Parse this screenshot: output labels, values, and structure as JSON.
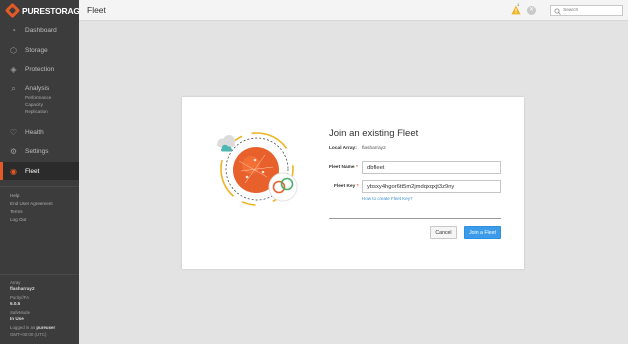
{
  "brand": {
    "logo_text": "PURESTORAGE",
    "accent": "#e25a26"
  },
  "sidebar": {
    "nav": [
      {
        "label": "Dashboard",
        "icon": "dashboard-icon"
      },
      {
        "label": "Storage",
        "icon": "storage-icon"
      },
      {
        "label": "Protection",
        "icon": "shield-icon"
      },
      {
        "label": "Analysis",
        "icon": "analysis-icon"
      },
      {
        "label": "Health",
        "icon": "health-icon"
      },
      {
        "label": "Settings",
        "icon": "gear-icon"
      },
      {
        "label": "Fleet",
        "icon": "fleet-icon"
      }
    ],
    "analysis_sub": [
      "Performance",
      "Capacity",
      "Replication"
    ],
    "active": "Fleet",
    "help_links": [
      "Help",
      "End User Agreement",
      "Terms",
      "Log Out"
    ],
    "info": {
      "array_label": "Array",
      "array_value": "flasharray2",
      "purity_label": "Purity//FA",
      "purity_value": "6.0.5",
      "safemode_label": "SafeMode",
      "safemode_value": "In Use",
      "logged_in_text": "Logged in as",
      "user": "pureuser",
      "timezone": "GMT+00:00 (UTC)"
    }
  },
  "topbar": {
    "title": "Fleet",
    "alert_count": "1",
    "search_placeholder": "Search"
  },
  "dialog": {
    "title": "Join an existing Fleet",
    "local_array_label": "Local Array:",
    "local_array_value": "flasharray2",
    "fleet_name_label": "Fleet Name",
    "fleet_name_value": "dbfleet",
    "fleet_key_label": "Fleet Key",
    "fleet_key_value": "ybsxy4hgor6tt5m2jmdqxqxjt3z9ny",
    "required_mark": "*",
    "help_link": "How to create Fleet Key?",
    "cancel_label": "Cancel",
    "join_label": "Join a Fleet",
    "primary_color": "#3b9be9"
  }
}
